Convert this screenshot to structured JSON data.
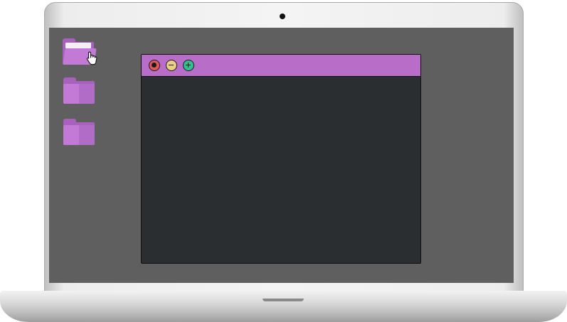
{
  "desktop": {
    "folders": [
      {
        "icon": "folder-open-icon",
        "state": "hovered"
      },
      {
        "icon": "folder-icon"
      },
      {
        "icon": "folder-icon"
      }
    ],
    "cursor": "hand-pointer-icon"
  },
  "window": {
    "controls": [
      {
        "icon": "close-icon",
        "color": "#e25a58"
      },
      {
        "icon": "minimize-icon",
        "color": "#e9cf86"
      },
      {
        "icon": "maximize-icon",
        "color": "#34c08e"
      }
    ],
    "titlebar_color": "#b86ec8",
    "body_color": "#2b2e31"
  },
  "colors": {
    "screen": "#5f5f5f",
    "folder": "#b86ec8"
  }
}
